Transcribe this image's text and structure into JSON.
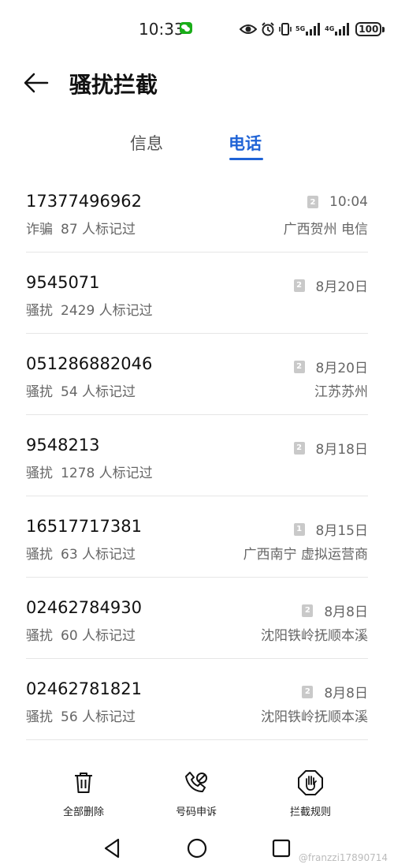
{
  "status_bar": {
    "time": "10:33",
    "network_1": "5G",
    "network_2": "4G",
    "battery": "100"
  },
  "header": {
    "title": "骚扰拦截"
  },
  "tabs": [
    {
      "label": "信息",
      "active": false
    },
    {
      "label": "电话",
      "active": true
    }
  ],
  "accent_color": "#1f63d6",
  "calls": [
    {
      "number": "17377496962",
      "tag": "诈骗",
      "count": "87 人标记过",
      "sim": "2",
      "time": "10:04",
      "location": "广西贺州 电信"
    },
    {
      "number": "9545071",
      "tag": "骚扰",
      "count": "2429 人标记过",
      "sim": "2",
      "time": "8月20日",
      "location": ""
    },
    {
      "number": "051286882046",
      "tag": "骚扰",
      "count": "54 人标记过",
      "sim": "2",
      "time": "8月20日",
      "location": "江苏苏州"
    },
    {
      "number": "9548213",
      "tag": "骚扰",
      "count": "1278 人标记过",
      "sim": "2",
      "time": "8月18日",
      "location": ""
    },
    {
      "number": "16517717381",
      "tag": "骚扰",
      "count": "63 人标记过",
      "sim": "1",
      "time": "8月15日",
      "location": "广西南宁 虚拟运营商"
    },
    {
      "number": "02462784930",
      "tag": "骚扰",
      "count": "60 人标记过",
      "sim": "2",
      "time": "8月8日",
      "location": "沈阳铁岭抚顺本溪"
    },
    {
      "number": "02462781821",
      "tag": "骚扰",
      "count": "56 人标记过",
      "sim": "2",
      "time": "8月8日",
      "location": "沈阳铁岭抚顺本溪"
    }
  ],
  "actions": {
    "delete_all": "全部删除",
    "appeal": "号码申诉",
    "rules": "拦截规则"
  },
  "watermark": "@franzzi17890714"
}
